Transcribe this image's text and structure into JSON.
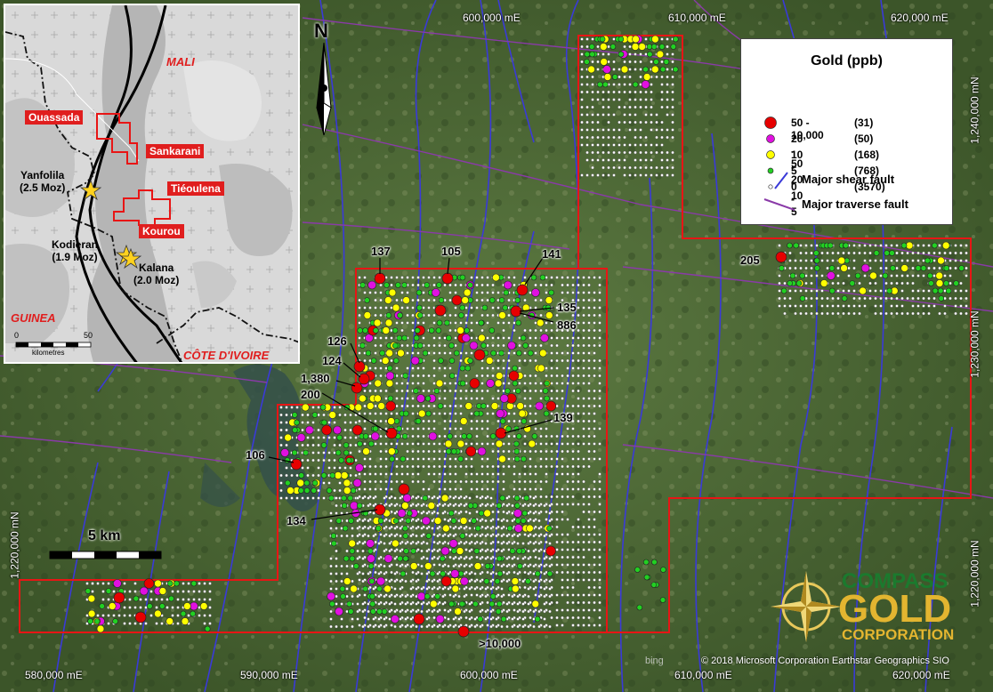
{
  "map": {
    "x_ticks": [
      "580,000 mE",
      "590,000 mE",
      "600,000 mE",
      "610,000 mE",
      "620,000 mE"
    ],
    "y_ticks_right": [
      "1,240,000 mN",
      "1,230,000 mN",
      "1,220,000 mN"
    ],
    "y_ticks_left": [
      "1,220,000 mN"
    ],
    "callouts": [
      "137",
      "105",
      "141",
      "135",
      "886",
      "126",
      "124",
      "1,380",
      "200",
      "139",
      "106",
      "134",
      ">10,000",
      "205"
    ],
    "north_letter": "N",
    "scale_label": "5 km",
    "copyright": "© 2018 Microsoft Corporation Earthstar Geographics  SIO",
    "bing_label": "bing"
  },
  "inset": {
    "countries": [
      "MALI",
      "GUINEA",
      "CÔTE D'IVOIRE"
    ],
    "permits": [
      "Ouassada",
      "Sankarani",
      "Tiéoulena",
      "Kourou"
    ],
    "mines": [
      "Yanfolila\n(2.5 Moz)",
      "Kodieran\n(1.9 Moz)",
      "Kalana\n(2.0 Moz)"
    ],
    "scale_ticks": [
      "0",
      "50"
    ],
    "scale_unit": "kilometres"
  },
  "legend": {
    "title": "Gold (ppb)",
    "rows": [
      {
        "range": "50 - 10,000",
        "count": "(31)",
        "color": "#e60000"
      },
      {
        "range": "20 - 50",
        "count": "(50)",
        "color": "#e010e0"
      },
      {
        "range": "10 - 20",
        "count": "(168)",
        "color": "#ffff00"
      },
      {
        "range": "5 - 10",
        "count": "(768)",
        "color": "#22d022"
      },
      {
        "range": "0 - 5",
        "count": "(3570)",
        "color": "#ffffff"
      }
    ],
    "shear_label": "Major shear fault",
    "traverse_label": "Major traverse fault",
    "shear_color": "#3a3ad8",
    "traverse_color": "#8a3aa8"
  },
  "logo": {
    "line1": "COMPASS",
    "line2": "GOLD",
    "line3": "CORPORATION"
  }
}
